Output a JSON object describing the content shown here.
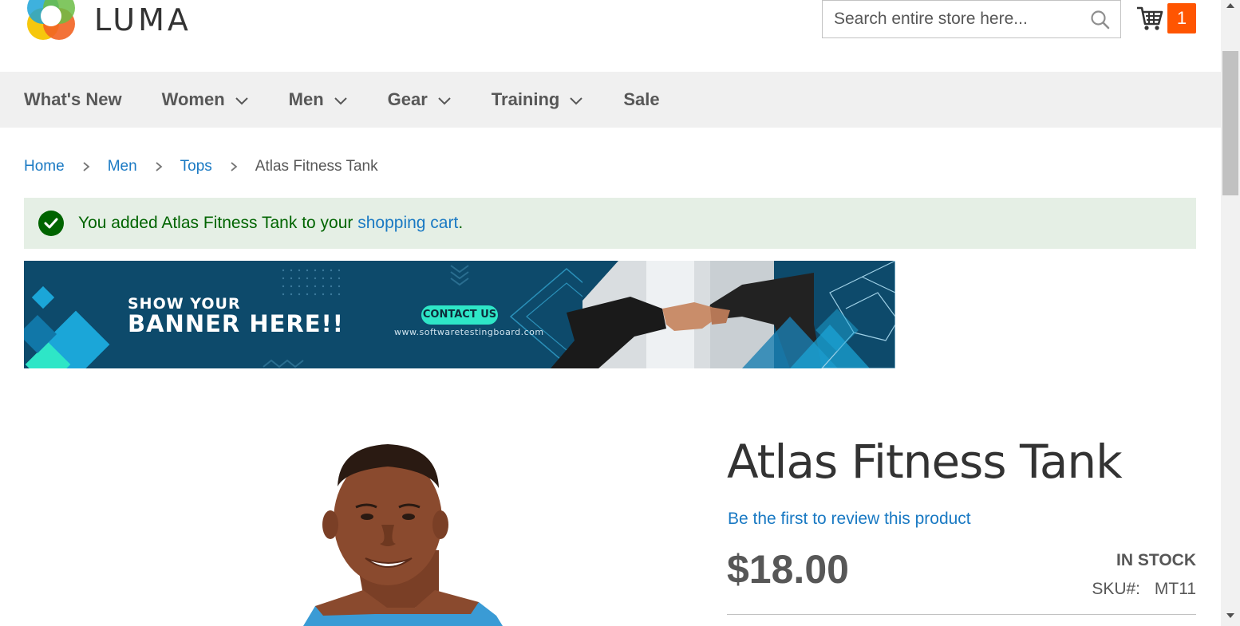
{
  "header": {
    "logo_text": "LUMA",
    "search": {
      "placeholder": "Search entire store here..."
    },
    "cart": {
      "count": "1"
    }
  },
  "nav": {
    "items": [
      {
        "label": "What's New",
        "has_dropdown": false
      },
      {
        "label": "Women",
        "has_dropdown": true
      },
      {
        "label": "Men",
        "has_dropdown": true
      },
      {
        "label": "Gear",
        "has_dropdown": true
      },
      {
        "label": "Training",
        "has_dropdown": true
      },
      {
        "label": "Sale",
        "has_dropdown": false
      }
    ]
  },
  "breadcrumb": {
    "items": [
      "Home",
      "Men",
      "Tops"
    ],
    "current": "Atlas Fitness Tank"
  },
  "message": {
    "prefix": "You added Atlas Fitness Tank to your ",
    "link": "shopping cart",
    "suffix": "."
  },
  "banner": {
    "line1": "SHOW YOUR",
    "line2": "BANNER HERE!!",
    "cta": "CONTACT US",
    "url": "www.softwaretestingboard.com"
  },
  "product": {
    "title": "Atlas Fitness Tank",
    "review_link": "Be the first to review this product",
    "price": "$18.00",
    "stock": "IN STOCK",
    "sku_label": "SKU#:",
    "sku_value": "MT11"
  },
  "colors": {
    "accent_link": "#1979c3",
    "cart_badge": "#ff5501",
    "success_bg": "#e5efe5",
    "success_text": "#006400",
    "nav_bg": "#f0f0f0"
  },
  "icons": {
    "search": "search-icon",
    "cart": "cart-icon",
    "check": "check-circle-icon",
    "chevron": "chevron-down-icon",
    "breadcrumb_sep": "chevron-right-icon"
  }
}
